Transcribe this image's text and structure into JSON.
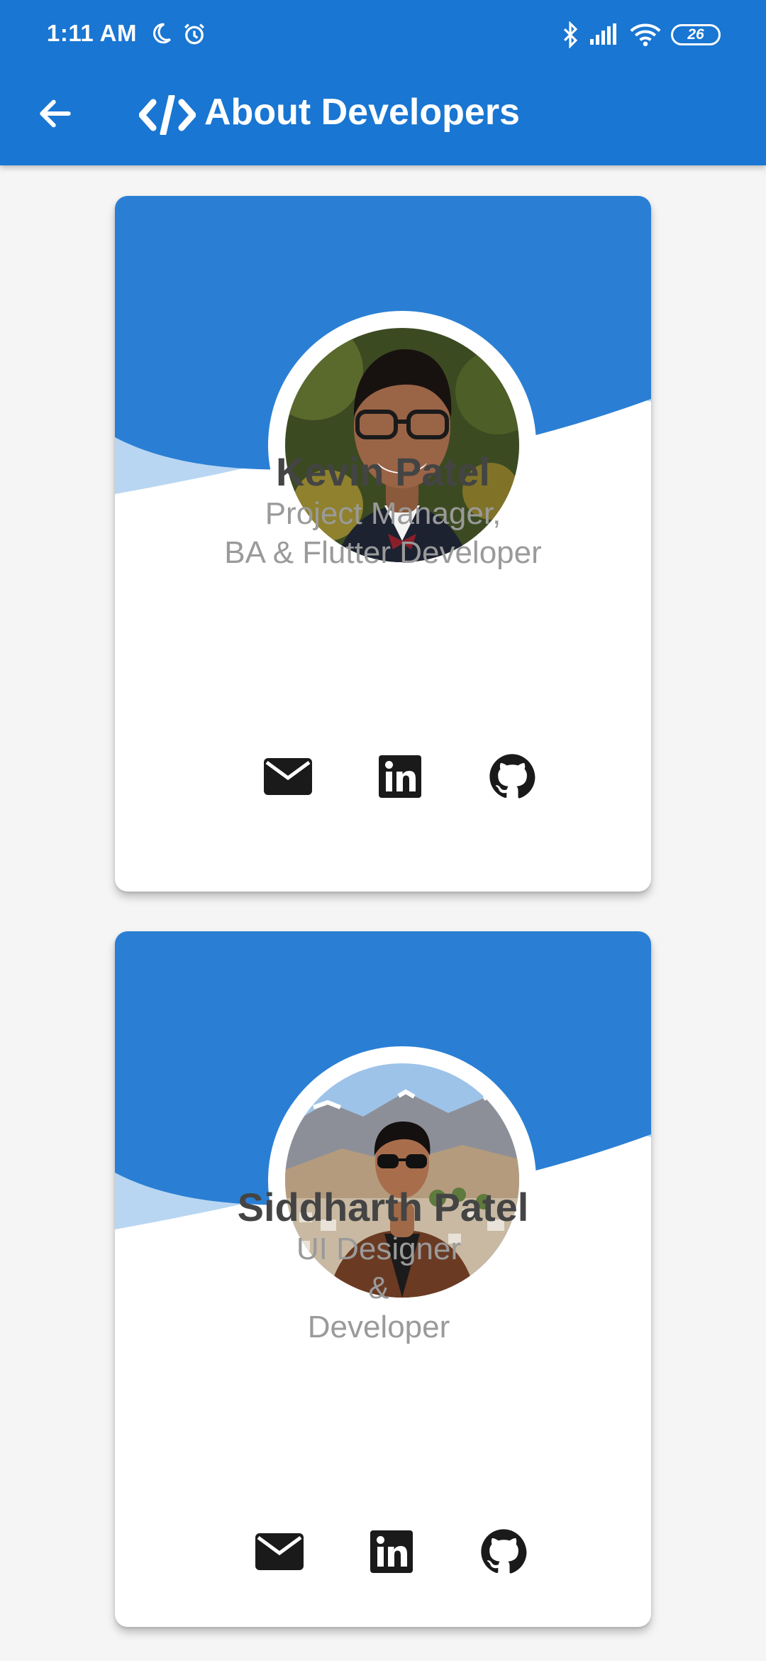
{
  "status_bar": {
    "time": "1:11 AM",
    "battery": "26",
    "icons": [
      "moon-icon",
      "alarm-icon",
      "bluetooth-icon",
      "signal-icon",
      "wifi-icon",
      "battery-icon"
    ]
  },
  "app_bar": {
    "title": "About Developers",
    "icons": [
      "back-arrow-icon",
      "code-icon"
    ]
  },
  "developers": [
    {
      "name": "Kevin Patel",
      "role_lines": [
        "Project Manager,",
        "BA & Flutter Developer"
      ],
      "links": [
        "email-icon",
        "linkedin-icon",
        "github-icon"
      ]
    },
    {
      "name": "Siddharth Patel",
      "role_lines": [
        "UI Designer",
        "&",
        "Developer"
      ],
      "links": [
        "email-icon",
        "linkedin-icon",
        "github-icon"
      ]
    }
  ],
  "colors": {
    "primary": "#1976d2",
    "card_header": "#2a7fd4",
    "card_wave": "#b8d6f2",
    "name_text": "#444444",
    "role_text": "#9a9a9a",
    "background": "#f5f5f5"
  }
}
